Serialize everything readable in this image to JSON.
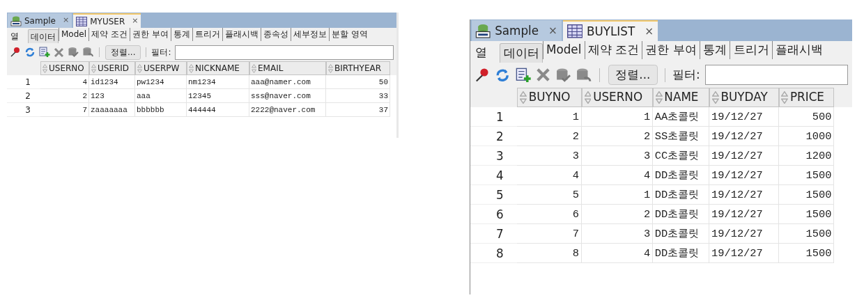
{
  "panels": [
    {
      "tabs": [
        {
          "label": "Sample",
          "kind": "sql",
          "close": "×",
          "selected": false
        },
        {
          "label": "MYUSER",
          "kind": "table",
          "close": "×",
          "selected": true
        }
      ],
      "subtabs": [
        {
          "label": "열",
          "selected": false
        },
        {
          "label": "데이터",
          "selected": true
        },
        {
          "label": "Model",
          "selected": false
        },
        {
          "label": "제약 조건",
          "selected": false
        },
        {
          "label": "권한 부여",
          "selected": false
        },
        {
          "label": "통계",
          "selected": false
        },
        {
          "label": "트리거",
          "selected": false
        },
        {
          "label": "플래시백",
          "selected": false
        },
        {
          "label": "종속성",
          "selected": false
        },
        {
          "label": "세부정보",
          "selected": false
        },
        {
          "label": "분할 영역",
          "selected": false
        }
      ],
      "toolbar": {
        "sort_button": "정렬...",
        "filter_label": "필터:"
      },
      "table": {
        "columns": [
          {
            "label": "USERNO",
            "kind": "number"
          },
          {
            "label": "USERID",
            "kind": "text"
          },
          {
            "label": "USERPW",
            "kind": "text"
          },
          {
            "label": "NICKNAME",
            "kind": "text"
          },
          {
            "label": "EMAIL",
            "kind": "text"
          },
          {
            "label": "BIRTHYEAR",
            "kind": "number"
          }
        ],
        "rows": [
          {
            "number": "1",
            "cells": [
              "4",
              "id1234",
              "pw1234",
              "nm1234",
              "aaa@namer.com",
              "50"
            ]
          },
          {
            "number": "2",
            "cells": [
              "2",
              "123",
              "aaa",
              "12345",
              "sss@naver.com",
              "33"
            ]
          },
          {
            "number": "3",
            "cells": [
              "7",
              "zaaaaaaa",
              "bbbbbb",
              "444444",
              "2222@naver.com",
              "37"
            ]
          }
        ]
      }
    },
    {
      "tabs": [
        {
          "label": "Sample",
          "kind": "sql",
          "close": "×",
          "selected": false
        },
        {
          "label": "BUYLIST",
          "kind": "table",
          "close": "×",
          "selected": true
        }
      ],
      "subtabs": [
        {
          "label": "열",
          "selected": false
        },
        {
          "label": "데이터",
          "selected": true
        },
        {
          "label": "Model",
          "selected": false
        },
        {
          "label": "제약 조건",
          "selected": false
        },
        {
          "label": "권한 부여",
          "selected": false
        },
        {
          "label": "통계",
          "selected": false
        },
        {
          "label": "트리거",
          "selected": false
        },
        {
          "label": "플래시백",
          "selected": false
        }
      ],
      "toolbar": {
        "sort_button": "정렬...",
        "filter_label": "필터:"
      },
      "table": {
        "columns": [
          {
            "label": "BUYNO",
            "kind": "number"
          },
          {
            "label": "USERNO",
            "kind": "number"
          },
          {
            "label": "NAME",
            "kind": "text"
          },
          {
            "label": "BUYDAY",
            "kind": "text"
          },
          {
            "label": "PRICE",
            "kind": "number"
          }
        ],
        "rows": [
          {
            "number": "1",
            "cells": [
              "1",
              "1",
              "AA초콜릿",
              "19/12/27",
              "500"
            ]
          },
          {
            "number": "2",
            "cells": [
              "2",
              "2",
              "SS초콜릿",
              "19/12/27",
              "1000"
            ]
          },
          {
            "number": "3",
            "cells": [
              "3",
              "3",
              "CC초콜릿",
              "19/12/27",
              "1200"
            ]
          },
          {
            "number": "4",
            "cells": [
              "4",
              "4",
              "DD초콜릿",
              "19/12/27",
              "1500"
            ]
          },
          {
            "number": "5",
            "cells": [
              "5",
              "1",
              "DD초콜릿",
              "19/12/27",
              "1500"
            ]
          },
          {
            "number": "6",
            "cells": [
              "6",
              "2",
              "DD초콜릿",
              "19/12/27",
              "1500"
            ]
          },
          {
            "number": "7",
            "cells": [
              "7",
              "3",
              "DD초콜릿",
              "19/12/27",
              "1500"
            ]
          },
          {
            "number": "8",
            "cells": [
              "8",
              "4",
              "DD초콜릿",
              "19/12/27",
              "1500"
            ]
          }
        ]
      }
    }
  ]
}
